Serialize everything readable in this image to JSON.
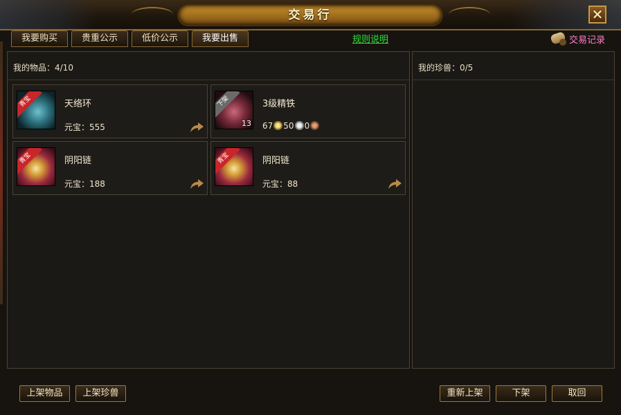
{
  "window": {
    "title": "交易行",
    "close_label": "✕"
  },
  "tabs": [
    {
      "label": "我要购买",
      "active": false
    },
    {
      "label": "贵重公示",
      "active": false
    },
    {
      "label": "低价公示",
      "active": false
    },
    {
      "label": "我要出售",
      "active": true
    }
  ],
  "rules_link": "规则说明",
  "records_label": "交易记录",
  "items_panel": {
    "header": "我的物品：4/10",
    "items": [
      {
        "name": "天络环",
        "price_label": "元宝：",
        "price": "555",
        "badge": "青宝",
        "icon": "ring-icon"
      },
      {
        "name": "3级精铁",
        "badge": "下架",
        "quantity": "13",
        "icon": "iron-ore-icon",
        "coins": {
          "gold": "67",
          "silver": "50",
          "copper": "0"
        }
      },
      {
        "name": "阴阳链",
        "price_label": "元宝：",
        "price": "188",
        "badge": "青宝",
        "icon": "chain-icon"
      },
      {
        "name": "阴阳链",
        "price_label": "元宝：",
        "price": "88",
        "badge": "青宝",
        "icon": "chain-icon"
      }
    ]
  },
  "pets_panel": {
    "header": "我的珍兽：0/5"
  },
  "buttons": {
    "list_item": "上架物品",
    "list_pet": "上架珍兽",
    "relist": "重新上架",
    "delist": "下架",
    "retrieve": "取回"
  },
  "colors": {
    "link": "#2fe03a",
    "records": "#ff7ec8",
    "badge_red": "#c8262a",
    "badge_gray": "#6a6a6a"
  }
}
